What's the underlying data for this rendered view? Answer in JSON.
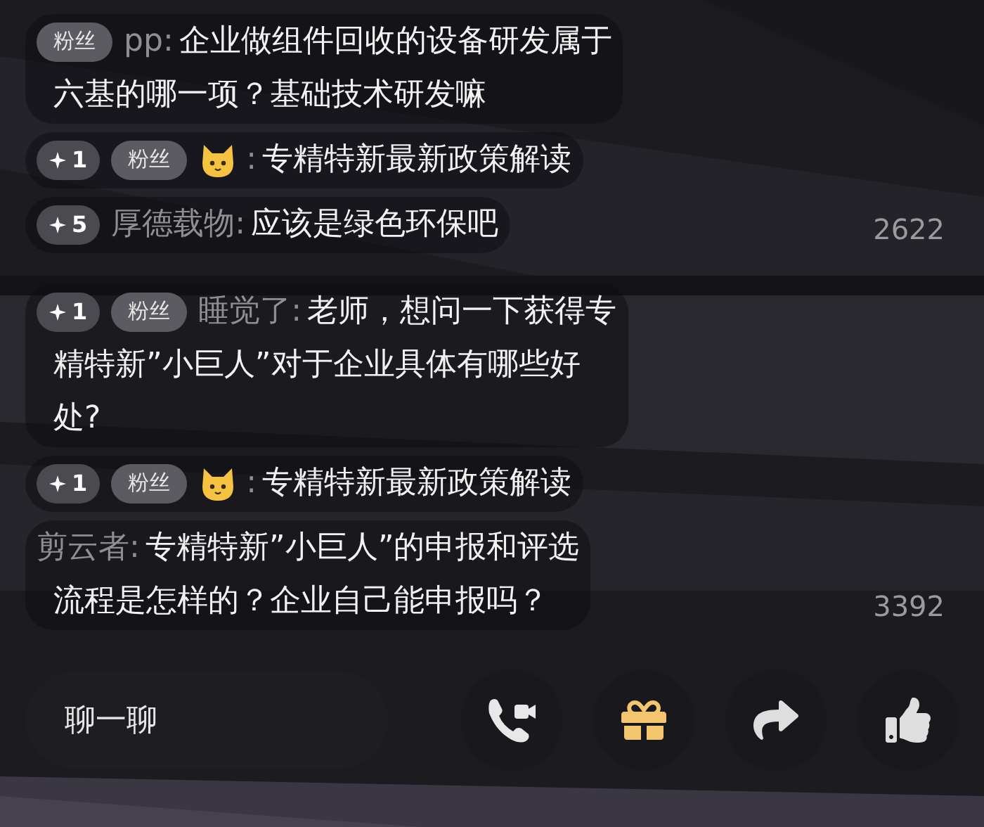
{
  "chat_groups": [
    {
      "messages": [
        {
          "kind": "named",
          "badge": "粉丝",
          "name": "pp",
          "sep": ":",
          "lines": [
            "企业做组件回收的设备研发属于",
            "六基的哪一项？基础技术研发嘛"
          ]
        },
        {
          "kind": "avatar",
          "boost": "1",
          "badge": "粉丝",
          "sep": ":",
          "lines": [
            "专精特新最新政策解读"
          ]
        },
        {
          "kind": "named",
          "boost": "5",
          "name": "厚德载物",
          "sep": ":",
          "lines": [
            "应该是绿色环保吧"
          ]
        }
      ],
      "count": "2622"
    },
    {
      "messages": [
        {
          "kind": "named",
          "boost": "1",
          "badge": "粉丝",
          "name": "睡觉了",
          "sep": ":",
          "lines": [
            "老师，想问一下获得专",
            "精特新”小巨人”对于企业具体有哪些好",
            "处?"
          ]
        },
        {
          "kind": "avatar",
          "boost": "1",
          "badge": "粉丝",
          "sep": ":",
          "lines": [
            "专精特新最新政策解读"
          ]
        },
        {
          "kind": "named",
          "name": "剪云者",
          "sep": ":",
          "lines": [
            "专精特新”小巨人”的申报和评选",
            "流程是怎样的？企业自己能申报吗？"
          ]
        }
      ],
      "count": "3392"
    }
  ],
  "chat_input": {
    "placeholder": "聊一聊"
  },
  "actions": [
    {
      "kind": "call"
    },
    {
      "kind": "gift"
    },
    {
      "kind": "share"
    },
    {
      "kind": "like"
    }
  ]
}
